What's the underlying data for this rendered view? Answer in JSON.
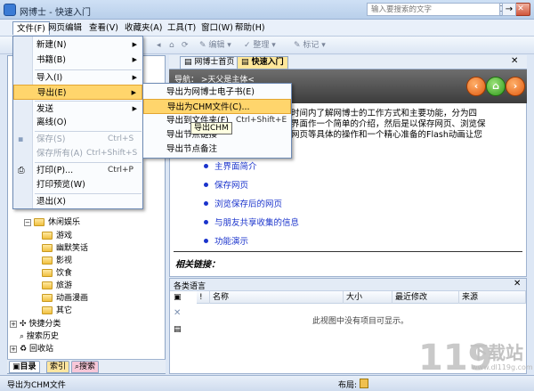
{
  "window": {
    "title": "网博士 - 快速入门"
  },
  "menubar": {
    "items": [
      "文件(F)",
      "网页编辑",
      "查看(V)",
      "收藏夹(A)",
      "工具(T)",
      "窗口(W)",
      "帮助(H)"
    ]
  },
  "toolbar": {
    "edit_label": "编辑",
    "organize_label": "整理",
    "tag_label": "标记",
    "search_placeholder": "输入要搜索的文字"
  },
  "file_menu": {
    "items": [
      {
        "label": "新建(N)",
        "shortcut": "",
        "submenu": true
      },
      {
        "label": "书籍(B)",
        "shortcut": "",
        "submenu": true
      },
      {
        "label": "导入(I)",
        "shortcut": "",
        "submenu": true
      },
      {
        "label": "导出(E)",
        "shortcut": "",
        "submenu": true
      },
      {
        "label": "发送",
        "shortcut": "",
        "submenu": true
      },
      {
        "label": "离线(O)",
        "shortcut": "",
        "submenu": false
      },
      {
        "label": "保存(S)",
        "shortcut": "Ctrl+S",
        "submenu": false
      },
      {
        "label": "保存所有(A)",
        "shortcut": "Ctrl+Shift+S",
        "submenu": false
      },
      {
        "label": "打印(P)...",
        "shortcut": "Ctrl+P",
        "submenu": false
      },
      {
        "label": "打印预览(W)",
        "shortcut": "",
        "submenu": false
      },
      {
        "label": "退出(X)",
        "shortcut": "",
        "submenu": false
      }
    ]
  },
  "export_menu": {
    "items": [
      {
        "label": "导出为网博士电子书(E)",
        "shortcut": ""
      },
      {
        "label": "导出为CHM文件(C)...",
        "shortcut": ""
      },
      {
        "label": "导出到文件夹(F)",
        "shortcut": "Ctrl+Shift+E"
      },
      {
        "label": "导出节点链接",
        "shortcut": ""
      },
      {
        "label": "导出节点备注",
        "shortcut": ""
      }
    ]
  },
  "tooltip": "导出CHM",
  "tree": {
    "leisure": "休闲娱乐",
    "leisure_children": [
      "游戏",
      "幽默笑话",
      "影视",
      "饮食",
      "旅游",
      "动画漫画",
      "其它"
    ],
    "roots": [
      "快捷分类",
      "搜索历史",
      "回收站"
    ]
  },
  "left_tabs": [
    "目录",
    "索引",
    "搜索"
  ],
  "tabs": [
    "网博士首页",
    "快速入门"
  ],
  "nav": {
    "text": "导航：  >天父是主体<"
  },
  "content": {
    "para_lines": [
      "时间内了解网博士的工作方式和主要功能，分为四",
      "界面作一个简单的介绍，然后是以保存网页、浏览保",
      "网页等具体的操作和一个精心准备的Flash动画让您"
    ],
    "links": [
      "主界面简介",
      "保存网页",
      "浏览保存后的网页",
      "与朋友共享收集的信息",
      "功能演示"
    ],
    "related": "相关链接："
  },
  "bottom_pane": {
    "title": "各类语言",
    "columns": [
      "名称",
      "大小",
      "最近修改",
      "来源"
    ],
    "empty_text": "此视图中没有项目可显示。"
  },
  "status": {
    "text": "导出为CHM文件",
    "layout_label": "布局:"
  },
  "watermark": {
    "text": "下载站",
    "url": "www.dl119g.com"
  }
}
